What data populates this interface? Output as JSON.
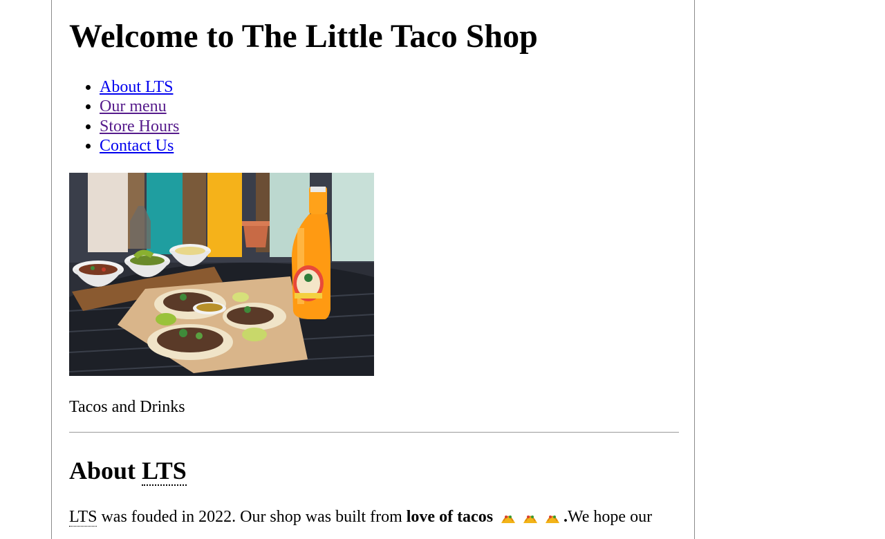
{
  "header": {
    "title": "Welcome to The Little Taco Shop"
  },
  "nav": {
    "items": [
      {
        "label": "About LTS",
        "visited": false
      },
      {
        "label": "Our menu",
        "visited": true
      },
      {
        "label": "Store Hours",
        "visited": true
      },
      {
        "label": "Contact Us",
        "visited": false
      }
    ]
  },
  "hero": {
    "image_icon": "tacos-and-drinks-photo",
    "caption": "Tacos and Drinks"
  },
  "about": {
    "heading_prefix": "About ",
    "heading_abbr": "LTS",
    "para_abbr": "LTS",
    "para_text_1": " was fouded in 2022. Our shop was built from ",
    "para_bold": "love of tacos",
    "para_period": ".",
    "para_text_2": "We hope our",
    "emoji_count": 3
  },
  "colors": {
    "link": "#0000ee",
    "visited_link": "#551a8b",
    "border": "#8a8a8a"
  }
}
